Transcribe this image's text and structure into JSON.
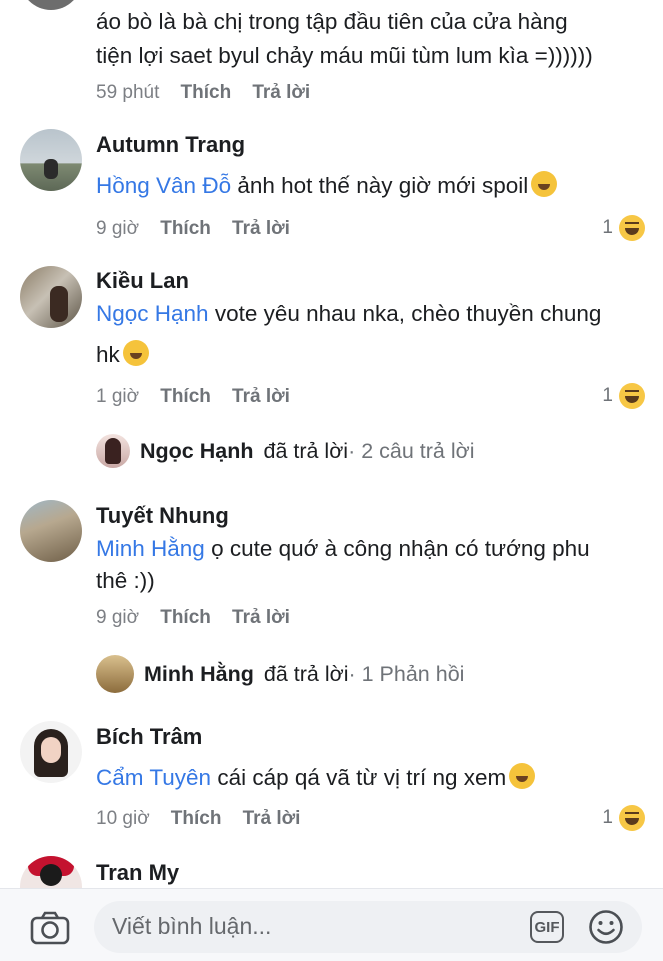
{
  "top_comment": {
    "line1": "áo bò là bà chị trong tập đầu tiên của cửa hàng",
    "line2": "tiện lợi saet byul chảy máu mũi tùm lum kìa =))))))",
    "time": "59 phút",
    "like": "Thích",
    "reply": "Trả lời"
  },
  "comments": [
    {
      "name": "Autumn Trang",
      "mention": "Hồng Vân Đỗ",
      "text": " ảnh hot thế này giờ mới spoil",
      "time": "9 giờ",
      "like": "Thích",
      "reply": "Trả lời",
      "reaction_count": "1"
    },
    {
      "name": "Kiều Lan",
      "mention": "Ngọc Hạnh",
      "text": " vote yêu nhau nka, chèo thuyền chung",
      "text2": "hk",
      "time": "1 giờ",
      "like": "Thích",
      "reply": "Trả lời",
      "reaction_count": "1",
      "replies": {
        "name": "Ngọc Hạnh",
        "action": "đã trả lời",
        "count": " · 2 câu trả lời"
      }
    },
    {
      "name": "Tuyết Nhung",
      "mention": "Minh Hằng",
      "text": " ọ cute quớ à công nhận có tướng phu",
      "text2": "thê :))",
      "time": "9 giờ",
      "like": "Thích",
      "reply": "Trả lời",
      "replies": {
        "name": "Minh Hằng",
        "action": "đã trả lời",
        "count": " · 1 Phản hồi"
      }
    },
    {
      "name": "Bích Trâm",
      "mention": "Cẩm Tuyên",
      "text": " cái cáp qá vã từ vị trí ng xem",
      "time": "10 giờ",
      "like": "Thích",
      "reply": "Trả lời",
      "reaction_count": "1"
    },
    {
      "name": "Tran My"
    }
  ],
  "composer": {
    "placeholder": "Viết bình luận...",
    "gif": "GIF",
    "icons": [
      "camera-icon",
      "gif-icon",
      "emoji-icon"
    ]
  },
  "colors": {
    "mention": "#3578e5",
    "meta": "#7c7f84"
  }
}
